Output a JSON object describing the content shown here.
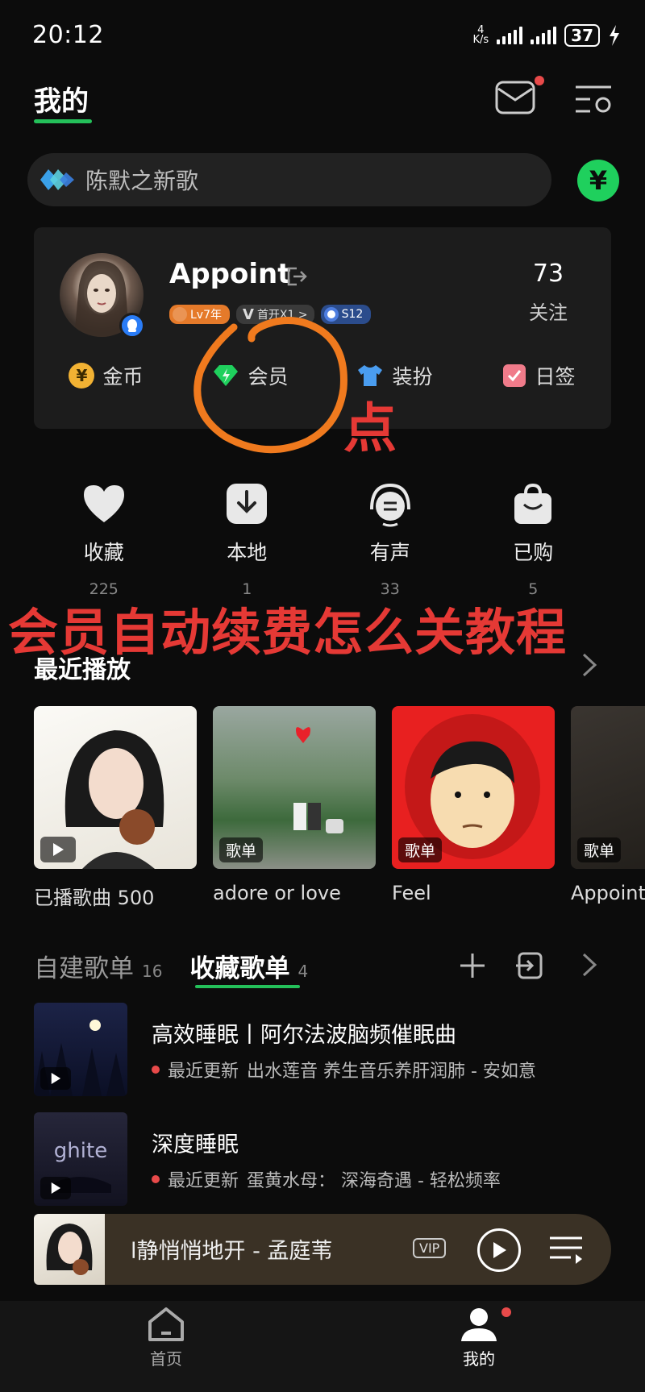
{
  "status_bar": {
    "time": "20:12",
    "net_speed_value": "4",
    "net_speed_unit": "K/s",
    "battery": "37"
  },
  "header": {
    "tab_label": "我的",
    "icons": [
      "mail-icon",
      "menu-settings-icon"
    ]
  },
  "search": {
    "placeholder": "陈默之新歌",
    "yuan_label": "¥"
  },
  "profile": {
    "username": "Appoint",
    "badge_level": "Lv7年",
    "badge_vip": "首开X1 >",
    "badge_season": "S12",
    "follow_count": "73",
    "follow_label": "关注"
  },
  "card_actions": [
    {
      "label": "金币",
      "icon": "coin-icon",
      "color": "#f2b233"
    },
    {
      "label": "会员",
      "icon": "diamond-icon",
      "color": "#1fd05d"
    },
    {
      "label": "装扮",
      "icon": "tshirt-icon",
      "color": "#4a9df0"
    },
    {
      "label": "日签",
      "icon": "checkbox-icon",
      "color": "#f07b8a"
    }
  ],
  "annotations": {
    "tap_hint": "点",
    "headline": "会员自动续费怎么关教程",
    "color": "#e53935",
    "scribble_color": "#f07a1e"
  },
  "quick_actions": [
    {
      "label": "收藏",
      "count": "225",
      "icon": "heart-icon"
    },
    {
      "label": "本地",
      "count": "1",
      "icon": "download-icon"
    },
    {
      "label": "有声",
      "count": "33",
      "icon": "audio-icon"
    },
    {
      "label": "已购",
      "count": "5",
      "icon": "bag-icon"
    }
  ],
  "recent": {
    "title": "最近播放",
    "items": [
      {
        "name": "已播歌曲 500",
        "tag": ""
      },
      {
        "name": "adore or love",
        "tag": "歌单"
      },
      {
        "name": "Feel",
        "tag": "歌单"
      },
      {
        "name": "Appoint",
        "tag": "歌单"
      }
    ]
  },
  "playlists": {
    "tab_created": "自建歌单",
    "tab_created_count": "16",
    "tab_collected": "收藏歌单",
    "tab_collected_count": "4",
    "items": [
      {
        "name": "高效睡眠丨阿尔法波脑频催眠曲",
        "update_label": "最近更新",
        "update_text": "出水莲音 养生音乐养肝润肺 - 安如意"
      },
      {
        "name": "深度睡眠",
        "update_label": "最近更新",
        "update_text": "蛋黄水母： 深海奇遇 - 轻松频率"
      }
    ]
  },
  "player": {
    "title": "l静悄悄地开 - 孟庭苇",
    "vip": "VIP"
  },
  "bottom_nav": {
    "home": "首页",
    "mine": "我的"
  }
}
